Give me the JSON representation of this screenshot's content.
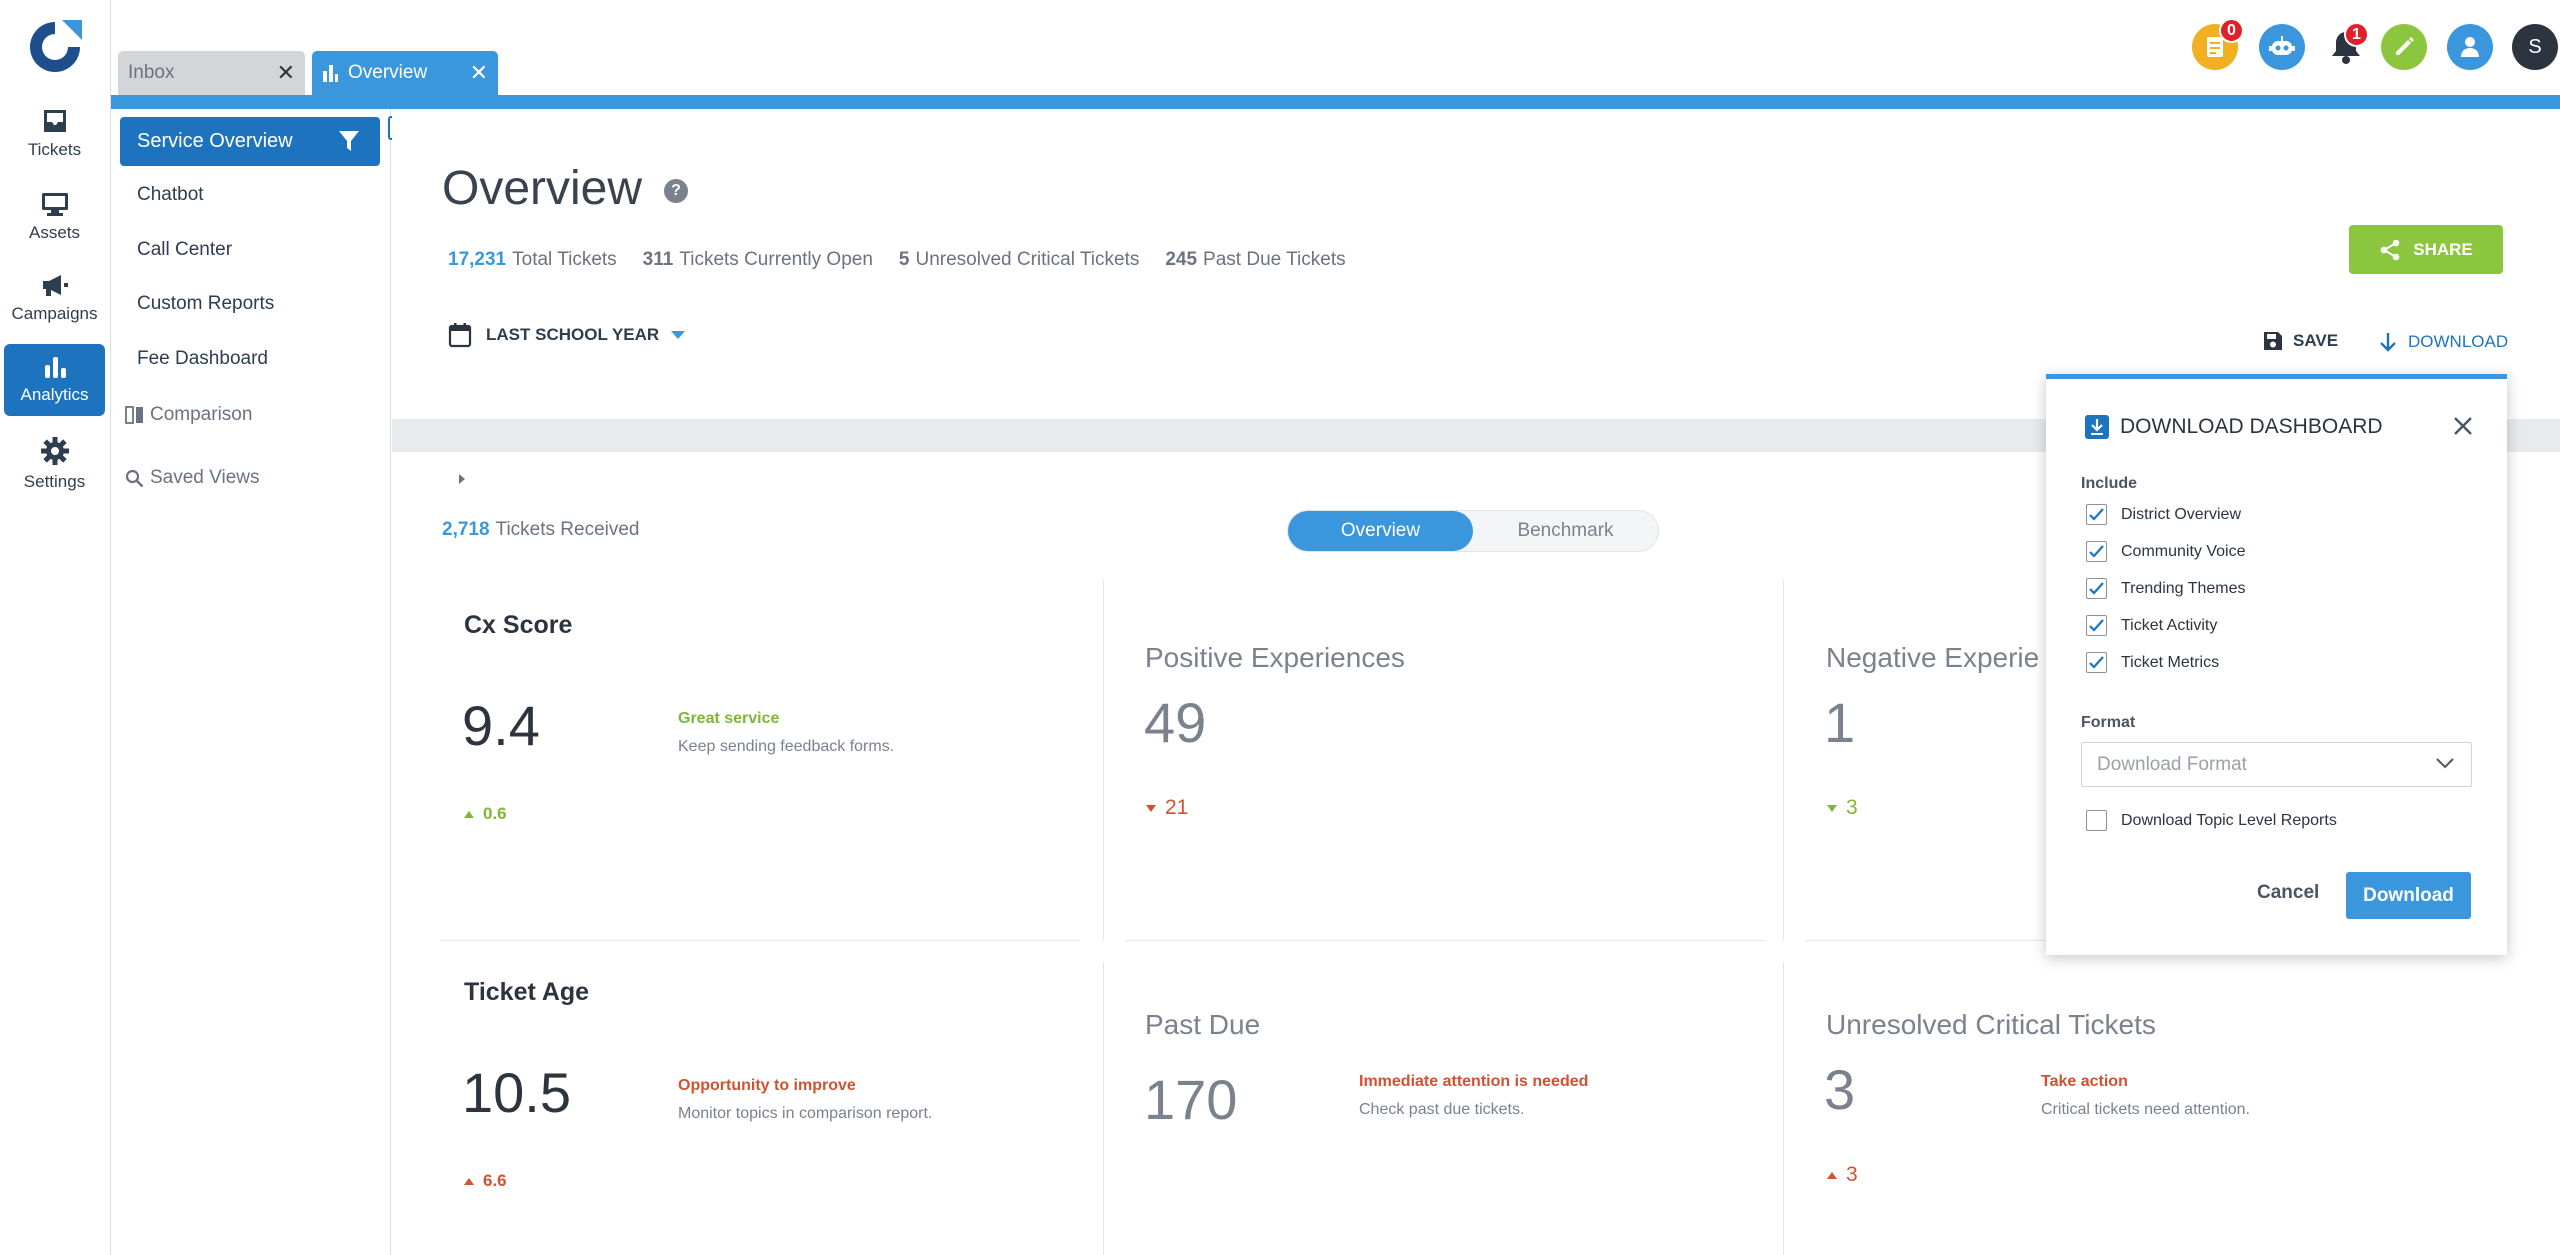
{
  "app": {
    "brand_color": "#1e73be",
    "accent_color": "#3b97dd",
    "success_color": "#8cc63f",
    "danger_color": "#d0532f"
  },
  "rail": {
    "items": [
      {
        "label": "Tickets",
        "icon": "inbox-tray-icon"
      },
      {
        "label": "Assets",
        "icon": "monitor-icon"
      },
      {
        "label": "Campaigns",
        "icon": "megaphone-icon"
      },
      {
        "label": "Analytics",
        "icon": "bar-chart-icon",
        "active": true
      },
      {
        "label": "Settings",
        "icon": "gear-icon"
      }
    ]
  },
  "tabs": [
    {
      "label": "Inbox",
      "close": "✕"
    },
    {
      "label": "Overview",
      "close": "✕",
      "active": true
    }
  ],
  "top_icons": {
    "notes_badge": "0",
    "bell_badge": "1",
    "avatar_initial": "S"
  },
  "subnav": {
    "active_label": "Service Overview",
    "items": [
      "Chatbot",
      "Call Center",
      "Custom Reports",
      "Fee Dashboard"
    ],
    "groups": [
      "Comparison",
      "Saved Views"
    ]
  },
  "header": {
    "title": "Overview",
    "help": "?",
    "stats": [
      {
        "value": "17,231",
        "label": "Total Tickets"
      },
      {
        "value": "311",
        "label": "Tickets Currently Open"
      },
      {
        "value": "5",
        "label": "Unresolved Critical Tickets"
      },
      {
        "value": "245",
        "label": "Past Due Tickets"
      }
    ],
    "share_label": "SHARE",
    "date_filter": "LAST SCHOOL YEAR",
    "save_label": "SAVE",
    "download_label": "DOWNLOAD"
  },
  "body": {
    "received_count": "2,718",
    "received_label": "Tickets Received",
    "toggle": [
      "Overview",
      "Benchmark"
    ],
    "cards": {
      "cx": {
        "title": "Cx Score",
        "value": "9.4",
        "hint_title": "Great service",
        "hint_sub": "Keep sending feedback forms.",
        "delta": "0.6"
      },
      "positive": {
        "title": "Positive Experiences",
        "value": "49",
        "delta": "21"
      },
      "negative": {
        "title": "Negative Experie",
        "value": "1",
        "delta": "3"
      },
      "age": {
        "title": "Ticket Age",
        "value": "10.5",
        "hint_title": "Opportunity to improve",
        "hint_sub": "Monitor topics in comparison report.",
        "delta": "6.6"
      },
      "pastdue": {
        "title": "Past Due",
        "value": "170",
        "hint_title": "Immediate attention is needed",
        "hint_sub": "Check past due tickets."
      },
      "critical": {
        "title": "Unresolved Critical Tickets",
        "value": "3",
        "hint_title": "Take action",
        "hint_sub": "Critical tickets need attention.",
        "delta": "3"
      }
    }
  },
  "dialog": {
    "title": "DOWNLOAD DASHBOARD",
    "include_label": "Include",
    "includes": [
      "District Overview",
      "Community Voice",
      "Trending Themes",
      "Ticket Activity",
      "Ticket Metrics"
    ],
    "format_label": "Format",
    "format_placeholder": "Download Format",
    "topic_reports_label": "Download Topic Level Reports",
    "cancel_label": "Cancel",
    "download_label": "Download"
  }
}
